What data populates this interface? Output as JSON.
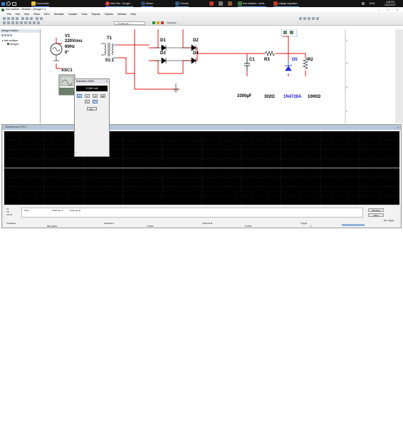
{
  "taskbar": {
    "apps": [
      {
        "label": "Documents"
      },
      {
        "label": "New Tab - Google ..."
      },
      {
        "label": "Steam"
      },
      {
        "label": "Friends"
      },
      {
        "label": "test multisim - Multi..."
      },
      {
        "label": "voltage regulator..."
      }
    ],
    "tray": {
      "lang": "ENG",
      "time": "4:45 PM",
      "date": "10/22/2017"
    }
  },
  "window": {
    "title": "test multisim - Multisim - [Design1 *]"
  },
  "menu": [
    "File",
    "Edit",
    "View",
    "Place",
    "MCU",
    "Simulate",
    "Transfer",
    "Tools",
    "Reports",
    "Options",
    "Window",
    "Help"
  ],
  "toolbar": {
    "in_use_list": "--- In-Use List ---",
    "interactive": "Interactive"
  },
  "toolbox": {
    "title": "Design Toolbox",
    "project": "test multisim",
    "design": "Design1"
  },
  "schematic": {
    "labels": {
      "v1": "V1",
      "v1_volt": "220Vrms",
      "v1_freq": "60Hz",
      "v1_phase": "0°",
      "t1": "T1",
      "t1_ratio": "51:1",
      "d1": "D1",
      "d2": "D2",
      "d3": "D3",
      "d4": "D4",
      "c1": "C1",
      "r3": "R3",
      "d5": "D5",
      "r2": "R2",
      "xsc1": "XSC1",
      "c1_val": "3300µF",
      "r3_val": "302Ω",
      "d5_val": "1N4728A",
      "r2_val": "1000Ω"
    },
    "ruler": [
      "C",
      "D",
      "E",
      "F"
    ]
  },
  "multimeter": {
    "title": "Multimeter-XMM1",
    "reading": "3.186 mA",
    "buttons": [
      "A",
      "V",
      "Ω",
      "dB"
    ],
    "set_label": "Set..."
  },
  "oscilloscope": {
    "title": "Oscilloscope-XSC1",
    "columns": [
      "Time",
      "Channel_A",
      "Channel_B"
    ],
    "rows": [
      "T1",
      "T2",
      "T2-T1"
    ],
    "sections": {
      "timebase": "Timebase",
      "channel_a": "Channel A",
      "channel_b": "Channel B",
      "trigger": "Trigger"
    },
    "buttons": {
      "reverse": "Reverse",
      "save": "Save",
      "ext_trigger": "Ext. trigger"
    },
    "scale": {
      "timebase": "500 µs/Div",
      "channel_a": "5 V/Div",
      "channel_b": "5 V/Div",
      "trigger": "1"
    }
  },
  "colors": {
    "wire": "#e8140c",
    "zener": "#1e2fd2",
    "zener_label": "#1a1ad6"
  }
}
